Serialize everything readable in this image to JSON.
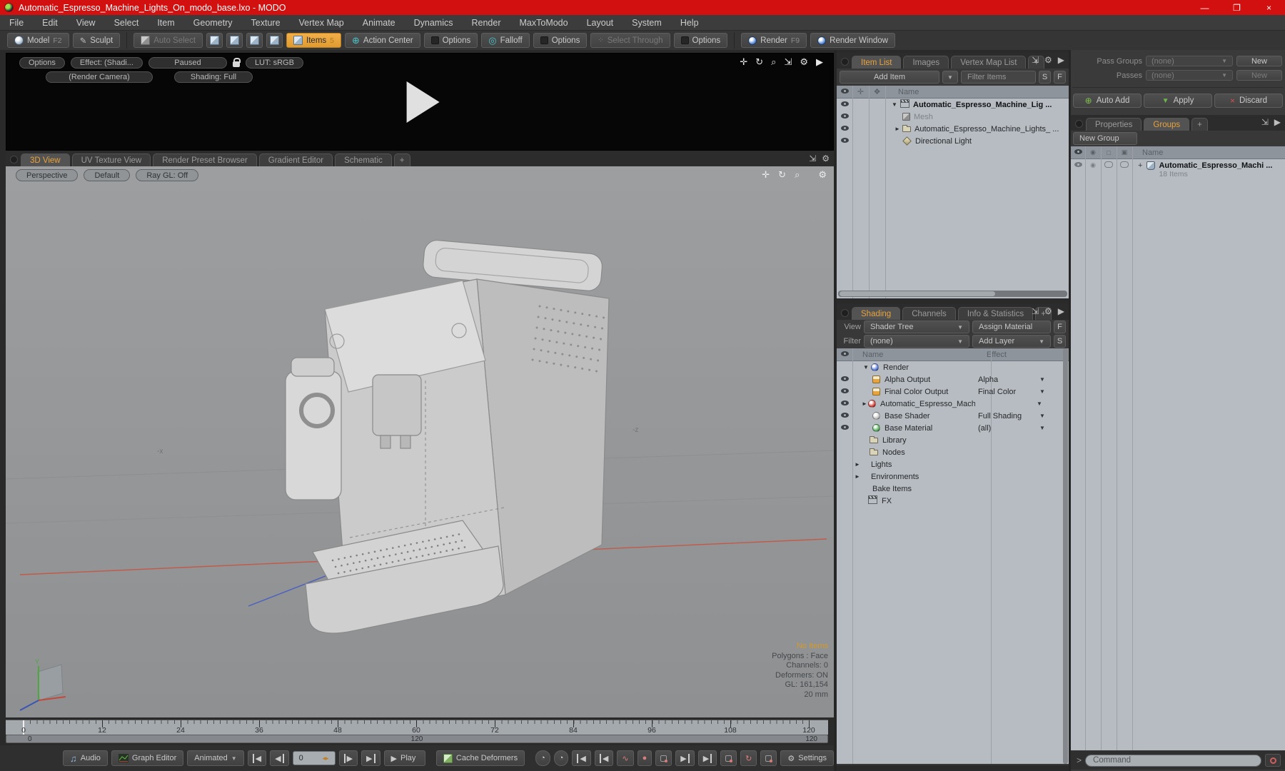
{
  "window": {
    "title": "Automatic_Espresso_Machine_Lights_On_modo_base.lxo - MODO",
    "minimize": "—",
    "maximize": "❐",
    "close": "×"
  },
  "menubar": {
    "items": [
      "File",
      "Edit",
      "View",
      "Select",
      "Item",
      "Geometry",
      "Texture",
      "Vertex Map",
      "Animate",
      "Dynamics",
      "Render",
      "MaxToModo",
      "Layout",
      "System",
      "Help"
    ]
  },
  "toolbar": {
    "model": "Model",
    "model_key": "F2",
    "sculpt": "Sculpt",
    "auto_select": "Auto Select",
    "items": "Items",
    "items_badge": "5",
    "action_center": "Action Center",
    "options_a": "Options",
    "falloff": "Falloff",
    "options_b": "Options",
    "select_through": "Select Through",
    "options_c": "Options",
    "render": "Render",
    "render_key": "F9",
    "render_window": "Render Window"
  },
  "glyphs": {
    "pan": "✛",
    "rotate": "↻",
    "zoom": "⌕",
    "expand": "⇲",
    "gear": "⚙",
    "arrow_right": "▶",
    "down": "▼",
    "right": "►",
    "pencil": "✎",
    "action_center": "⊕",
    "falloff": "◎",
    "note": "♫",
    "play": "▶",
    "rew": "◀",
    "dot": "●",
    "wave": "∿",
    "clock": "◔",
    "spin": "◂▸",
    "plus_green": "⊕"
  },
  "preview": {
    "options": "Options",
    "effect": "Effect: (Shadi...",
    "paused": "Paused",
    "lut": "LUT: sRGB",
    "render_camera": "(Render Camera)",
    "shading_full": "Shading: Full"
  },
  "viewport_tabs": {
    "t0": "3D View",
    "t1": "UV Texture View",
    "t2": "Render Preset Browser",
    "t3": "Gradient Editor",
    "t4": "Schematic",
    "add": "+"
  },
  "viewport": {
    "perspective": "Perspective",
    "default": "Default",
    "ray_gl": "Ray GL: Off",
    "axis_x_label": "-x",
    "axis_z_label": "-z",
    "gizmo_y": "Y",
    "status": {
      "no_items": "No Items",
      "polygons": "Polygons : Face",
      "channels": "Channels: 0",
      "deformers": "Deformers: ON",
      "gl": "GL: 161,154",
      "grid": "20 mm"
    }
  },
  "item_list": {
    "tab0": "Item List",
    "tab1": "Images",
    "tab2": "Vertex Map List",
    "add_tab": "+",
    "add_item": "Add Item",
    "filter": "Filter Items",
    "s": "S",
    "f": "F",
    "name_header": "Name",
    "rows": [
      {
        "name": "Automatic_Espresso_Machine_Lig ..."
      },
      {
        "name": "Mesh"
      },
      {
        "name": "Automatic_Espresso_Machine_Lights_ ..."
      },
      {
        "name": "Directional Light"
      }
    ]
  },
  "passes": {
    "pass_groups": "Pass Groups",
    "passes": "Passes",
    "pass_groups_value": "(none)",
    "passes_value": "(none)",
    "new_a": "New",
    "new_b": "New",
    "auto_add": "Auto Add",
    "apply": "Apply",
    "discard": "Discard"
  },
  "groups": {
    "tab0": "Properties",
    "tab1": "Groups",
    "add_tab": "+",
    "new_group": "New Group",
    "name_header": "Name",
    "row_plus": "+",
    "row_name": "Automatic_Espresso_Machi ...",
    "row_count": "18 Items"
  },
  "shading": {
    "tab0": "Shading",
    "tab1": "Channels",
    "tab2": "Info & Statistics",
    "add_tab": "+",
    "view_label": "View",
    "view_value": "Shader Tree",
    "assign_material": "Assign Material",
    "f": "F",
    "filter_label": "Filter",
    "filter_value": "(none)",
    "add_layer": "Add Layer",
    "s": "S",
    "name_header": "Name",
    "effect_header": "Effect",
    "rows": [
      {
        "name": "Render",
        "effect": ""
      },
      {
        "name": "Alpha Output",
        "effect": "Alpha"
      },
      {
        "name": "Final Color Output",
        "effect": "Final Color"
      },
      {
        "name": "Automatic_Espresso_Machi...",
        "effect": ""
      },
      {
        "name": "Base Shader",
        "effect": "Full Shading"
      },
      {
        "name": "Base Material",
        "effect": "(all)"
      },
      {
        "name": "Library",
        "effect": ""
      },
      {
        "name": "Nodes",
        "effect": ""
      },
      {
        "name": "Lights",
        "effect": ""
      },
      {
        "name": "Environments",
        "effect": ""
      },
      {
        "name": "Bake Items",
        "effect": ""
      },
      {
        "name": "FX",
        "effect": ""
      }
    ]
  },
  "timeline": {
    "ticks": [
      "0",
      "12",
      "24",
      "36",
      "48",
      "60",
      "72",
      "84",
      "96",
      "108",
      "120"
    ],
    "range_start": "0",
    "range_mid": "120",
    "range_end": "120"
  },
  "transport": {
    "audio": "Audio",
    "graph_editor": "Graph Editor",
    "animated": "Animated",
    "frame": "0",
    "play": "Play",
    "cache_deformers": "Cache Deformers",
    "settings": "Settings"
  },
  "command": {
    "prompt": ">",
    "placeholder": "Command"
  }
}
